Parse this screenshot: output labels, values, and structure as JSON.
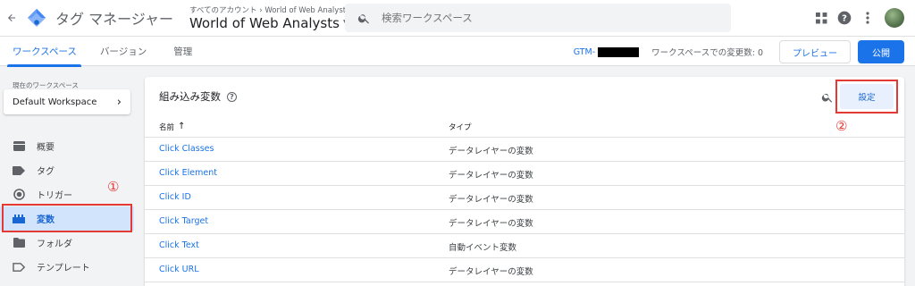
{
  "appbar": {
    "app_title": "タグ マネージャー",
    "account_crumb": "すべてのアカウント › World of Web Analysts",
    "container_name": "World of Web Analysts",
    "search_placeholder": "検索ワークスペース"
  },
  "tabs": [
    {
      "label": "ワークスペース",
      "active": true
    },
    {
      "label": "バージョン",
      "active": false
    },
    {
      "label": "管理",
      "active": false
    }
  ],
  "status": {
    "gtm_label": "GTM-",
    "changes_text": "ワークスペースでの変更数: 0",
    "preview_label": "プレビュー",
    "publish_label": "公開"
  },
  "sidebar": {
    "workspace_label": "現在のワークスペース",
    "workspace_name": "Default Workspace",
    "items": [
      {
        "label": "概要",
        "icon": "overview-icon"
      },
      {
        "label": "タグ",
        "icon": "tag-icon"
      },
      {
        "label": "トリガー",
        "icon": "trigger-icon"
      },
      {
        "label": "変数",
        "icon": "variables-icon",
        "active": true
      },
      {
        "label": "フォルダ",
        "icon": "folder-icon"
      },
      {
        "label": "テンプレート",
        "icon": "template-icon"
      }
    ]
  },
  "annotations": {
    "marker_1": "①",
    "marker_2": "②",
    "highlight_color": "#e53935"
  },
  "card": {
    "title": "組み込み変数",
    "help_symbol": "?",
    "settings_label": "設定",
    "col_name": "名前",
    "col_name_sort": "↑",
    "col_type": "タイプ",
    "rows": [
      {
        "name": "Click Classes",
        "type": "データレイヤーの変数"
      },
      {
        "name": "Click Element",
        "type": "データレイヤーの変数"
      },
      {
        "name": "Click ID",
        "type": "データレイヤーの変数"
      },
      {
        "name": "Click Target",
        "type": "データレイヤーの変数"
      },
      {
        "name": "Click Text",
        "type": "自動イベント変数"
      },
      {
        "name": "Click URL",
        "type": "データレイヤーの変数"
      }
    ]
  },
  "colors": {
    "accent": "#1a73e8",
    "active_nav_bg": "#d2e3fc"
  }
}
